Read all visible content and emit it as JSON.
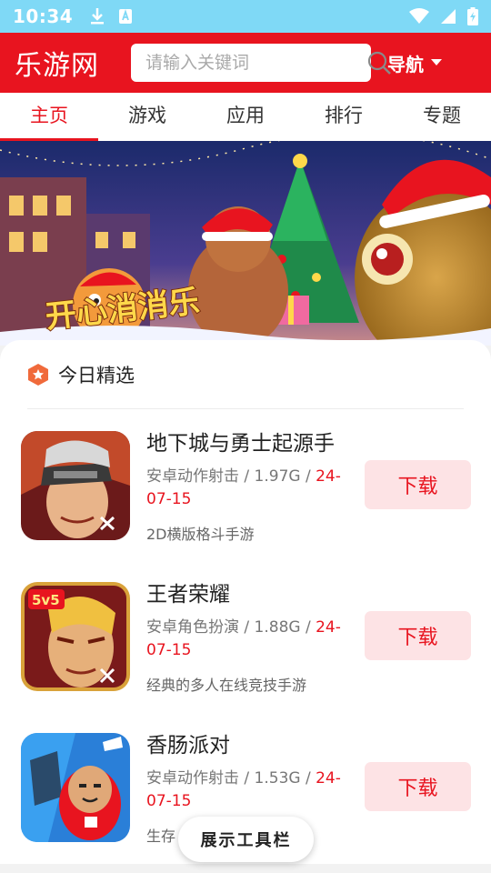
{
  "status_bar": {
    "time": "10:34",
    "icons": [
      "download-icon",
      "app-notification-icon",
      "wifi-icon",
      "signal-icon",
      "battery-icon"
    ]
  },
  "header": {
    "logo": "乐游网",
    "search_placeholder": "请输入关键词",
    "nav_label": "导航"
  },
  "tabs": [
    {
      "label": "主页",
      "active": true
    },
    {
      "label": "游戏",
      "active": false
    },
    {
      "label": "应用",
      "active": false
    },
    {
      "label": "排行",
      "active": false
    },
    {
      "label": "专题",
      "active": false
    }
  ],
  "banner": {
    "title": "开心消消乐"
  },
  "section": {
    "title": "今日精选"
  },
  "games": [
    {
      "name": "地下城与勇士起源手",
      "meta": "安卓动作射击 / 1.97G / ",
      "date": "24-07-15",
      "desc": "2D横版格斗手游",
      "button": "下载"
    },
    {
      "name": "王者荣耀",
      "meta": "安卓角色扮演 / 1.88G / ",
      "date": "24-07-15",
      "desc": "经典的多人在线竞技手游",
      "button": "下载"
    },
    {
      "name": "香肠派对",
      "meta": "安卓动作射击 / 1.53G / ",
      "date": "24-07-15",
      "desc": "生存",
      "button": "下载"
    }
  ],
  "toolbar": {
    "label": "展示工具栏"
  },
  "colors": {
    "brand_red": "#e8141f",
    "status_bar": "#7fd9f6",
    "download_bg": "#fde3e5"
  }
}
